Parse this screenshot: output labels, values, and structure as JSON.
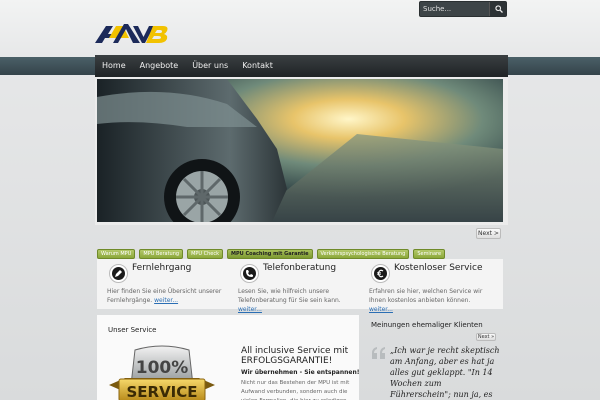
{
  "search": {
    "placeholder": "Suche..."
  },
  "nav": {
    "items": [
      "Home",
      "Angebote",
      "Über uns",
      "Kontakt"
    ]
  },
  "slider": {
    "next_label": "Next >"
  },
  "tabs": [
    "Warum MPU",
    "MPU Beratung",
    "MPU Check",
    "MPU Coaching mit Garantie",
    "Verkehrspsychologische Beratung",
    "Seminare"
  ],
  "features": [
    {
      "title": "Fernlehrgang",
      "text": "Hier finden Sie eine Übersicht unserer Fernlehrgänge.",
      "link": "weiter..."
    },
    {
      "title": "Telefonberatung",
      "text": "Lesen Sie, wie hilfreich unsere Telefonberatung für Sie sein kann.",
      "link": "weiter..."
    },
    {
      "title": "Kostenloser Service",
      "text": "Erfahren sie hier, welchen Service  wir Ihnen kostenlos anbieten können.",
      "link": "weiter..."
    }
  ],
  "service": {
    "title": "Unser Service",
    "badge_top": "100%",
    "badge_word": "SERVICE",
    "headline": "All inclusive Service mit ERFOLGSGARANTIE!",
    "subline": "Wir übernehmen - Sie entspannen!",
    "text": "Nicht nur das Bestehen der MPU ist mit Aufwand verbunden, sondern auch die vielen Formalien, die hier zu erledigen"
  },
  "testimonials": {
    "title": "Meinungen ehemaliger Klienten",
    "next_label": "Next »",
    "quote": "„Ich war je recht skeptisch am Anfang, aber es hat ja alles gut geklappt. \"In 14 Wochen zum Führerschein\"; nun ja, es war eine Woche"
  },
  "colors": {
    "tab_green": "#8ca83a",
    "nav_dark": "#1f2325",
    "link_blue": "#2a6eb4",
    "logo_gold": "#f2c200",
    "logo_navy": "#1c2a5a"
  }
}
